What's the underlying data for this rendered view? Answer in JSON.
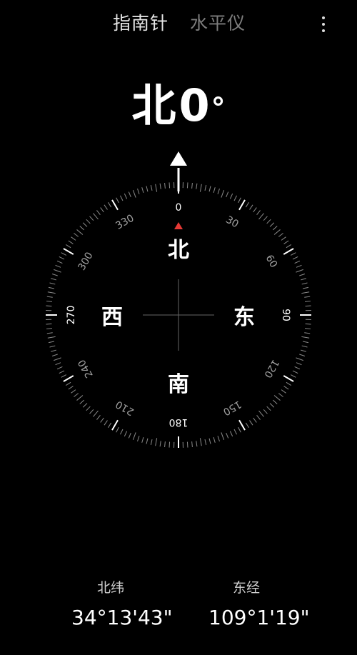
{
  "tabs": {
    "compass_label": "指南针",
    "level_label": "水平仪",
    "menu_icon": "more-vertical-icon"
  },
  "heading": {
    "direction": "北",
    "degrees": "0",
    "degree_sign": "°"
  },
  "dial": {
    "pointer_icon": "triangle-up-icon",
    "north_marker_color": "#e53935",
    "center_cross_icon": "crosshair-icon",
    "degree_labels": [
      "0",
      "30",
      "60",
      "90",
      "120",
      "150",
      "180",
      "210",
      "240",
      "270",
      "300",
      "330"
    ],
    "cardinals": {
      "north": "北",
      "east": "东",
      "south": "南",
      "west": "西"
    }
  },
  "location": {
    "latitude_label": "北纬",
    "latitude_value": "34°13'43\"",
    "longitude_label": "东经",
    "longitude_value": "109°1'19\""
  }
}
